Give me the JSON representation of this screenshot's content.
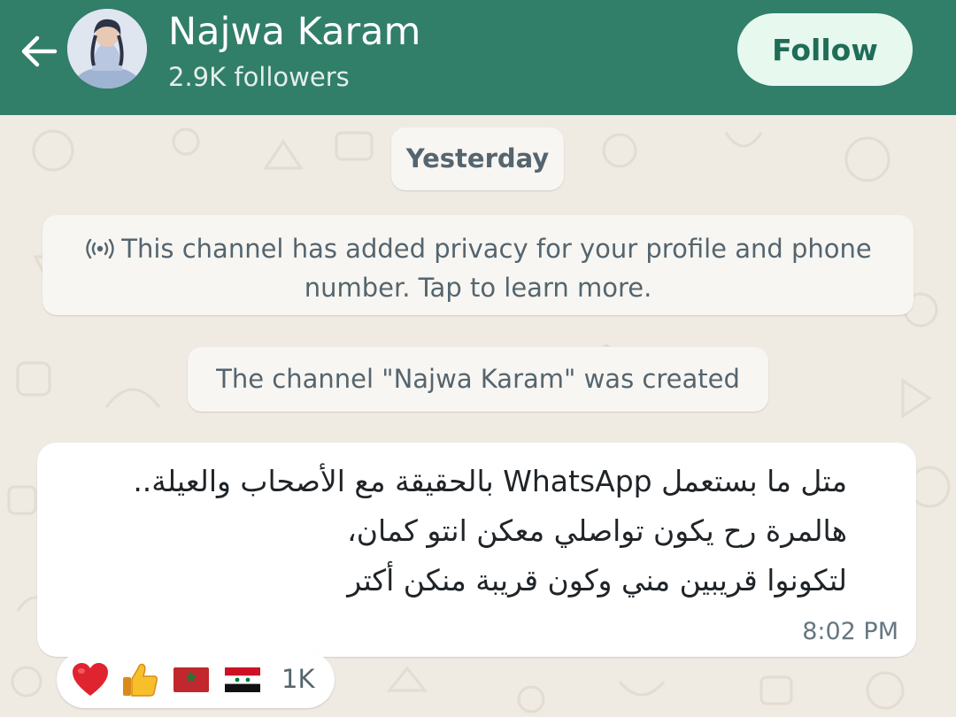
{
  "header": {
    "channel_name": "Najwa Karam",
    "followers": "2.9K followers",
    "follow_label": "Follow"
  },
  "chat": {
    "date_separator": "Yesterday",
    "privacy_notice": "This channel has added privacy for your profile and phone number. Tap to learn more.",
    "created_notice": "The channel \"Najwa Karam\" was created",
    "message": {
      "lines": [
        "متل ما بستعمل WhatsApp بالحقيقة مع الأصحاب والعيلة..",
        "هالمرة رح يكون تواصلي معكن انتو كمان،",
        "لتكونوا قريبين مني وكون قريبة منكن أكتر"
      ],
      "time": "8:02 PM"
    },
    "reactions": {
      "emojis": [
        "heart",
        "thumbs-up",
        "flag-morocco",
        "flag-syria"
      ],
      "count": "1K"
    }
  },
  "colors": {
    "header_bg": "#317e69",
    "follow_bg": "#e7f8ef",
    "follow_text": "#1f6d57",
    "chat_bg": "#efeae2",
    "bubble_bg": "#ffffff",
    "system_pill_bg": "#f8f6f2"
  }
}
